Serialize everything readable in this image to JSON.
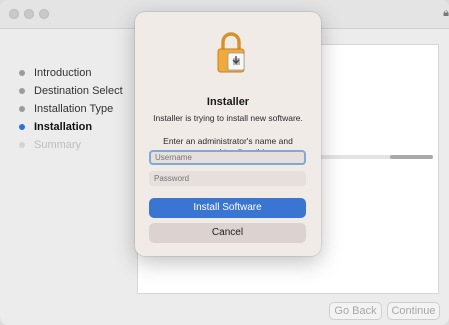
{
  "window": {
    "steps": [
      {
        "label": "Introduction",
        "state": "done"
      },
      {
        "label": "Destination Select",
        "state": "done"
      },
      {
        "label": "Installation Type",
        "state": "done"
      },
      {
        "label": "Installation",
        "state": "active"
      },
      {
        "label": "Summary",
        "state": "pending"
      }
    ],
    "go_back_label": "Go Back",
    "continue_label": "Continue",
    "progress": 0.35
  },
  "dialog": {
    "title": "Installer",
    "message": "Installer is trying to install new software.",
    "prompt": "Enter an administrator's name and password to allow this.",
    "username_placeholder": "Username",
    "password_placeholder": "Password",
    "username_value": "",
    "password_value": "",
    "primary_label": "Install Software",
    "secondary_label": "Cancel",
    "icon": "lock-icon"
  },
  "colors": {
    "accent": "#3a76d1",
    "active_step": "#2f6fe0"
  }
}
